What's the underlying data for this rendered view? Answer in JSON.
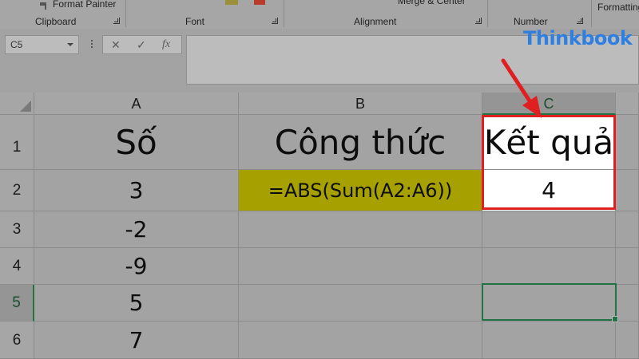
{
  "ribbon": {
    "format_painter": "Format Painter",
    "groups": [
      "Clipboard",
      "Font",
      "Alignment",
      "Number"
    ],
    "merge_center": "Merge & Center",
    "formatting": "Formatting"
  },
  "formula_bar": {
    "name_box": "C5",
    "cancel": "✕",
    "enter": "✓",
    "fx": "fx",
    "content": ""
  },
  "logo": "Thinkbook",
  "sheet": {
    "columns": [
      "A",
      "B",
      "C"
    ],
    "rows": [
      "1",
      "2",
      "3",
      "4",
      "5",
      "6"
    ],
    "active_row": "5",
    "active_col": "C",
    "cells": {
      "A1": "Số",
      "B1": "Công thức",
      "C1": "Kết quả",
      "A2": "3",
      "B2": "=ABS(Sum(A2:A6))",
      "C2": "4",
      "A3": "-2",
      "A4": "-9",
      "A5": "5",
      "A6": "7"
    }
  },
  "colors": {
    "highlight_olive": "#a6a100",
    "annotation_red": "#e02020",
    "selection_green": "#217346",
    "logo_blue": "#2f7fe0"
  }
}
